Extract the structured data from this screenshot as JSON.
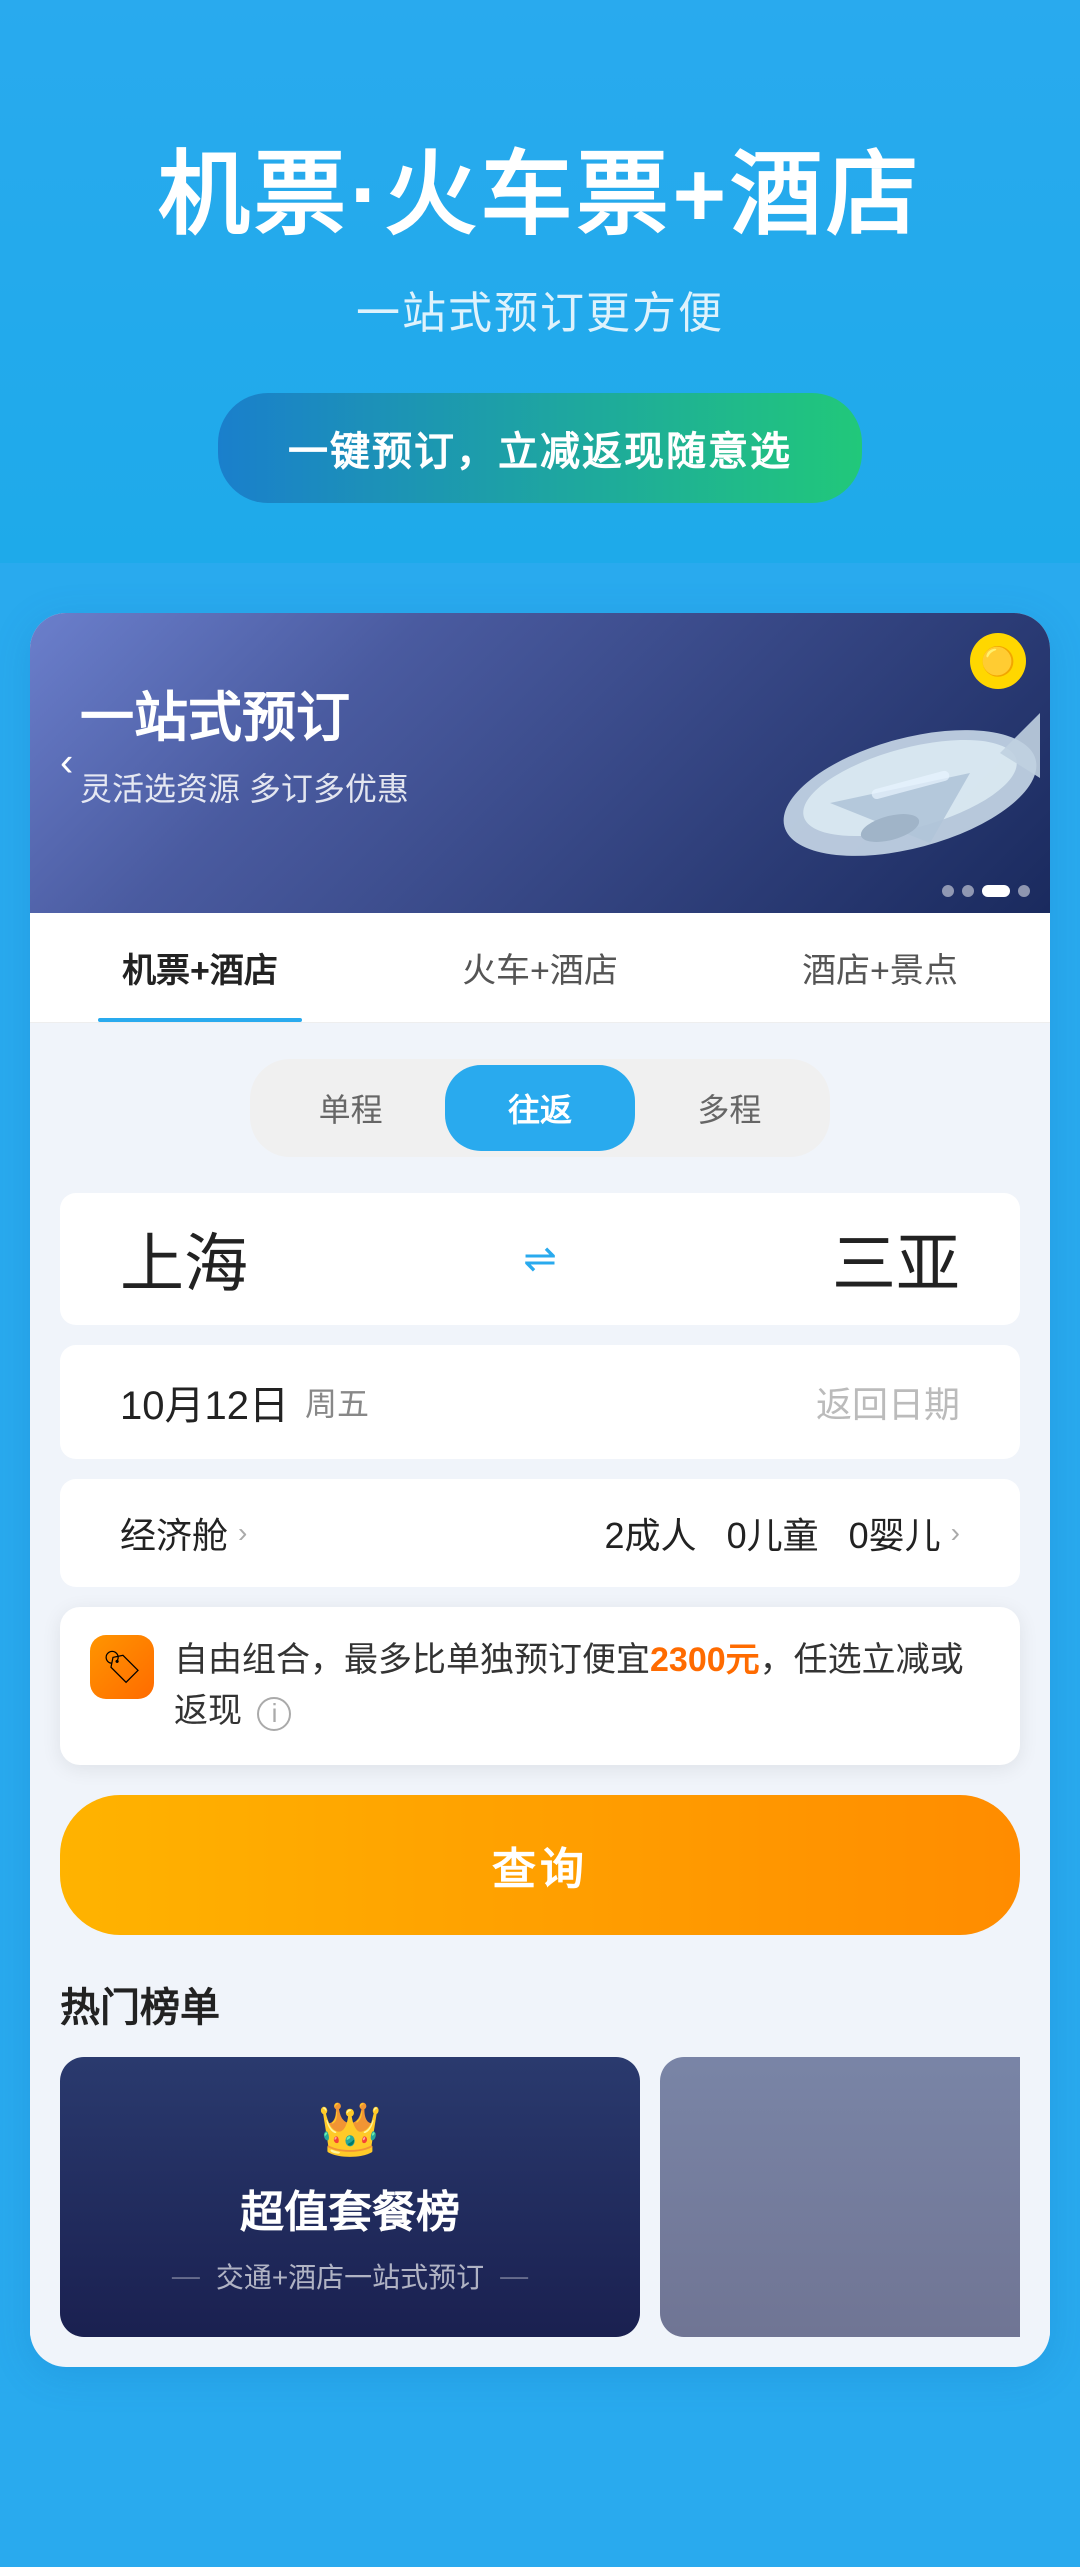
{
  "hero": {
    "title": "机票·火车票+酒店",
    "subtitle": "一站式预订更方便",
    "cta": "一键预订，立减返现随意选"
  },
  "card": {
    "banner": {
      "title": "一站式预订",
      "subtitle": "灵活选资源  多订多优惠",
      "back_icon": "‹",
      "badge": "🟡",
      "dots": [
        false,
        false,
        true,
        false
      ]
    },
    "tabs": [
      {
        "label": "机票+酒店",
        "active": true
      },
      {
        "label": "火车+酒店",
        "active": false
      },
      {
        "label": "酒店+景点",
        "active": false
      }
    ],
    "trip_types": [
      {
        "label": "单程",
        "active": false
      },
      {
        "label": "往返",
        "active": true
      },
      {
        "label": "多程",
        "active": false
      }
    ],
    "route": {
      "from": "上海",
      "to": "三亚",
      "swap_icon": "⇌"
    },
    "date": {
      "date": "10月12日",
      "day": "周五",
      "return_placeholder": "返回日期"
    },
    "cabin": {
      "class": "经济舱",
      "adults": "2",
      "children": "0",
      "infants": "0",
      "adults_label": "成人",
      "children_label": "儿童",
      "infants_label": "婴儿"
    },
    "promo": {
      "icon": "🏷",
      "text_before": "自由组合，最多比单独预订便宜",
      "highlight": "2300元",
      "text_after": "，任选立减或返现",
      "info_icon": "i"
    },
    "search_btn": "查询",
    "hot_list": {
      "title": "热门榜单",
      "cards": [
        {
          "crown": "👑",
          "title": "超值套餐榜",
          "subtitle": "交通+酒店一站式预订"
        }
      ]
    }
  }
}
